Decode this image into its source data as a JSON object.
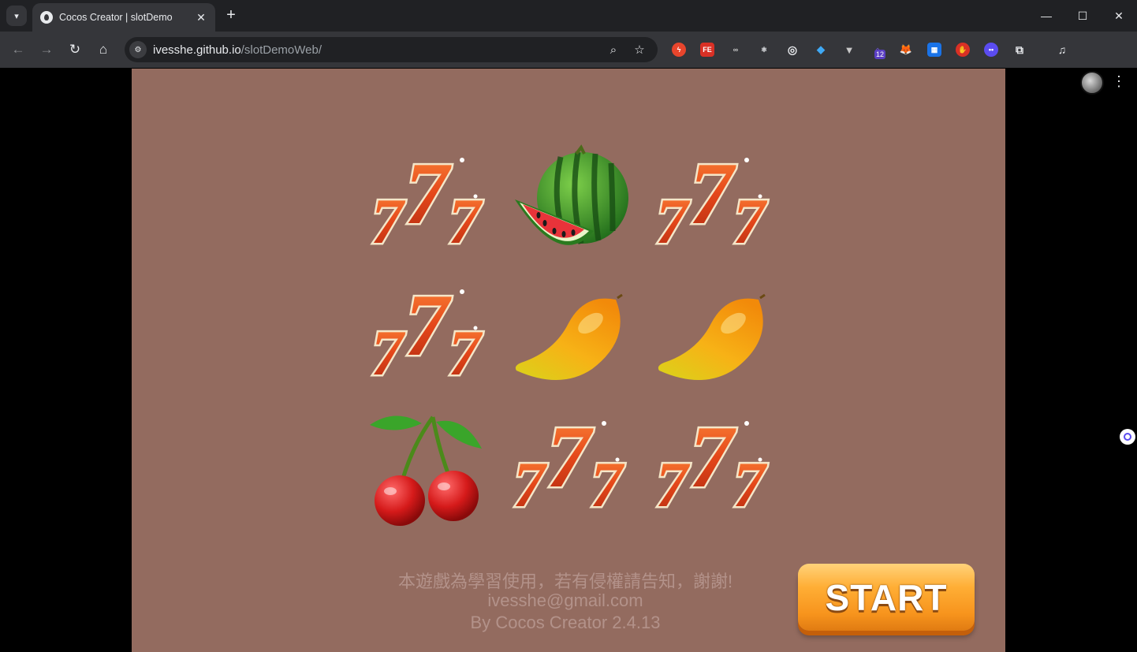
{
  "browser": {
    "tab_title": "Cocos Creator | slotDemo",
    "tab_close": "✕",
    "new_tab": "+",
    "url_host": "ivesshe.github.io",
    "url_path": "/slotDemoWeb/",
    "extension_badge": "12",
    "window_controls": {
      "minimize": "—",
      "maximize": "☐",
      "close": "✕"
    }
  },
  "reels": {
    "rows": [
      [
        "seven",
        "watermelon",
        "seven"
      ],
      [
        "seven",
        "mango",
        "mango"
      ],
      [
        "cherry",
        "seven",
        "seven"
      ]
    ]
  },
  "footer": {
    "line1": "本遊戲為學習使用，若有侵權請告知，謝謝!",
    "line2": "ivesshe@gmail.com",
    "line3": "By Cocos Creator 2.4.13"
  },
  "start_button": {
    "label": "START"
  },
  "colors": {
    "game_background": "#936b5f",
    "start_orange": "#f7941d",
    "footer_text": "#b3928a"
  }
}
